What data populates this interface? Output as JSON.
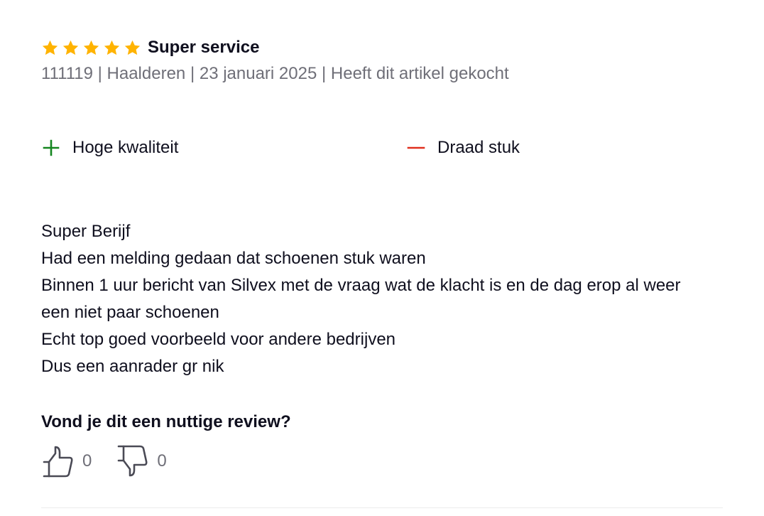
{
  "review": {
    "rating": 5,
    "rating_max": 5,
    "star_color": "#ffb300",
    "title": "Super service",
    "meta": "111119 | Haalderen | 23 januari 2025 | Heeft dit artikel gekocht",
    "pro": {
      "icon": "plus-icon",
      "color": "#14861f",
      "label": "Hoge kwaliteit"
    },
    "con": {
      "icon": "minus-icon",
      "color": "#e0301e",
      "label": "Draad stuk"
    },
    "body_lines": [
      "Super Berijf",
      "Had een melding gedaan dat schoenen stuk waren",
      "Binnen 1 uur bericht van Silvex met de vraag wat de klacht is en de dag erop al weer",
      "een niet paar schoenen",
      "Echt top goed voorbeeld voor andere bedrijven",
      "Dus een aanrader gr nik"
    ],
    "helpful_question": "Vond je dit een nuttige review?",
    "helpful_votes": {
      "up_icon": "thumbs-up-icon",
      "up_count": "0",
      "down_icon": "thumbs-down-icon",
      "down_count": "0"
    }
  }
}
